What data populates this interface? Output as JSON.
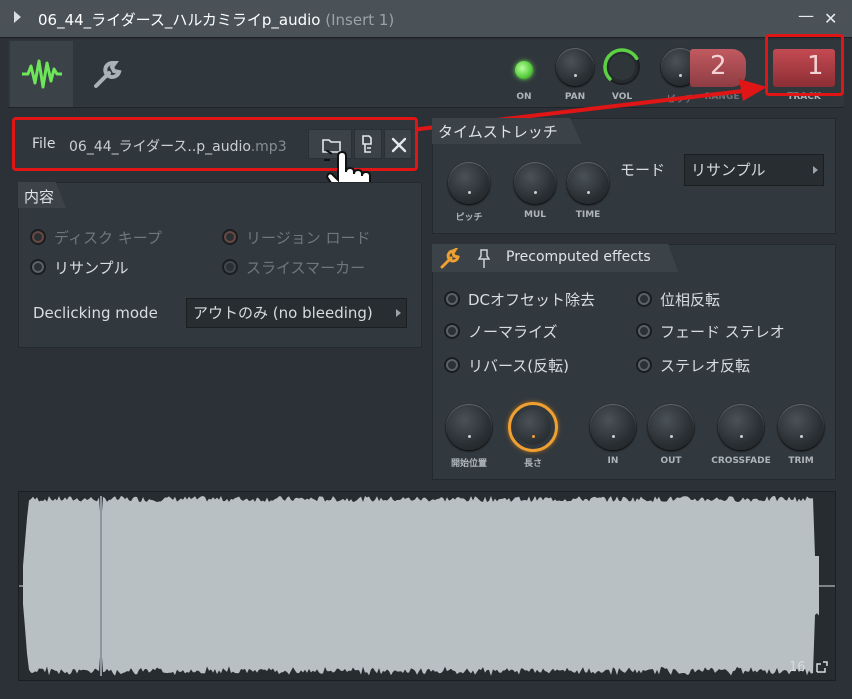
{
  "window": {
    "title": "06_44_ライダース_ハルカミライp_audio",
    "insert": "(Insert 1)",
    "min_glyph": "—",
    "close_glyph": "✕"
  },
  "toolbar": {
    "knobs": {
      "on": "ON",
      "pan": "PAN",
      "vol": "VOL",
      "pitch": "ピッチ",
      "range": "RANGE",
      "track": "TRACK"
    },
    "range_value": "2",
    "track_value": "1",
    "vol_level": 0.72
  },
  "file": {
    "label": "File",
    "name": "06_44_ライダース..p_audio",
    "ext": ".mp3"
  },
  "content": {
    "title": "内容",
    "options": [
      {
        "label": "ディスク キープ",
        "enabled": false
      },
      {
        "label": "リージョン ロード",
        "enabled": false
      },
      {
        "label": "リサンプル",
        "enabled": true
      },
      {
        "label": "スライスマーカー",
        "enabled": false
      }
    ],
    "declicking_label": "Declicking mode",
    "declicking_value": "アウトのみ (no bleeding)"
  },
  "timestretch": {
    "title": "タイムストレッチ",
    "knobs": [
      "ピッチ",
      "MUL",
      "TIME"
    ],
    "mode_label": "モード",
    "mode_value": "リサンプル"
  },
  "precomputed": {
    "title": "Precomputed effects",
    "options": [
      "DCオフセット除去",
      "位相反転",
      "ノーマライズ",
      "フェード ステレオ",
      "リバース(反転)",
      "ステレオ反転"
    ],
    "knobs": [
      "開始位置",
      "長さ",
      "IN",
      "OUT",
      "CROSSFADE",
      "TRIM"
    ]
  },
  "waveform": {
    "counter": "16"
  },
  "colors": {
    "accent_green": "#5dd144",
    "accent_orange": "#f0a030",
    "track_red": "#c44a52",
    "highlight_red": "#e01515"
  }
}
